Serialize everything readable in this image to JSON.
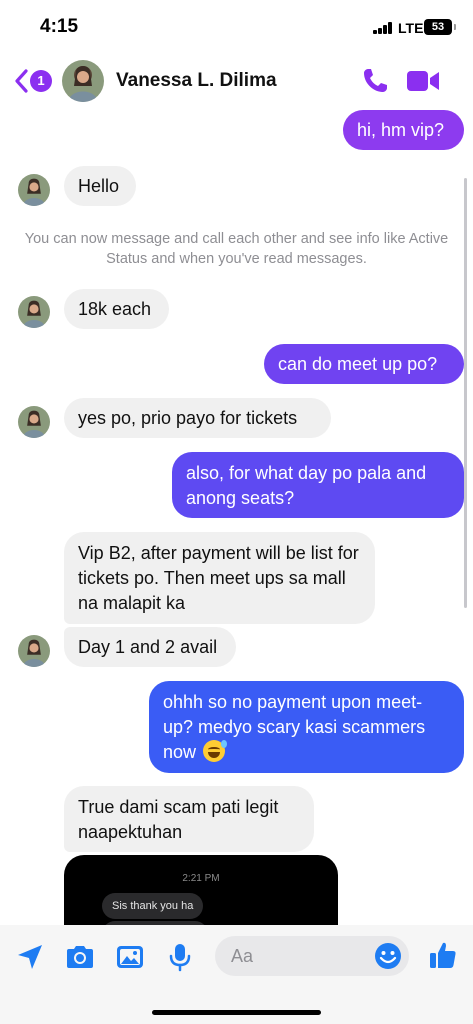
{
  "status_bar": {
    "time": "4:15",
    "network": "LTE",
    "battery": "53"
  },
  "header": {
    "unread_count": "1",
    "contact_name": "Vanessa L. Dilima",
    "accent_color": "#8b2ff0"
  },
  "messages": [
    {
      "id": "m1",
      "direction": "outgoing",
      "text": "hi, hm vip?"
    },
    {
      "id": "m2",
      "direction": "incoming",
      "text": "Hello"
    },
    {
      "id": "m3",
      "direction": "system",
      "text": "You can now message and call each other and see info like Active Status and when you've read messages."
    },
    {
      "id": "m4",
      "direction": "incoming",
      "text": "18k each"
    },
    {
      "id": "m5",
      "direction": "outgoing",
      "text": "can do meet up po?"
    },
    {
      "id": "m6",
      "direction": "incoming",
      "text": "yes po, prio payo for tickets"
    },
    {
      "id": "m7",
      "direction": "outgoing",
      "text": "also, for what day po pala and anong seats?"
    },
    {
      "id": "m8",
      "direction": "incoming",
      "text": "Vip B2, after payment will be list for tickets po. Then meet ups sa mall na malapit ka"
    },
    {
      "id": "m9",
      "direction": "incoming",
      "text": "Day 1 and 2 avail"
    },
    {
      "id": "m10",
      "direction": "outgoing",
      "text": "ohhh so no payment upon meet-up? medyo scary kasi scammers now"
    },
    {
      "id": "m11",
      "direction": "incoming",
      "text": "True dami scam pati legit naapektuhan"
    }
  ],
  "screenshot_attachment": {
    "time": "2:21 PM",
    "bubble_text": "Sis thank you ha"
  },
  "composer": {
    "placeholder": "Aa",
    "icons": [
      "location-arrow-icon",
      "camera-icon",
      "photo-icon",
      "microphone-icon",
      "emoji-icon",
      "thumbs-up-icon"
    ]
  },
  "colors": {
    "outgoing_gradient_top": "#8b3cf0",
    "outgoing_gradient_bottom": "#3a5cf5",
    "incoming_bubble": "#f0f0f0",
    "icon_blue": "#1e7cf2"
  }
}
